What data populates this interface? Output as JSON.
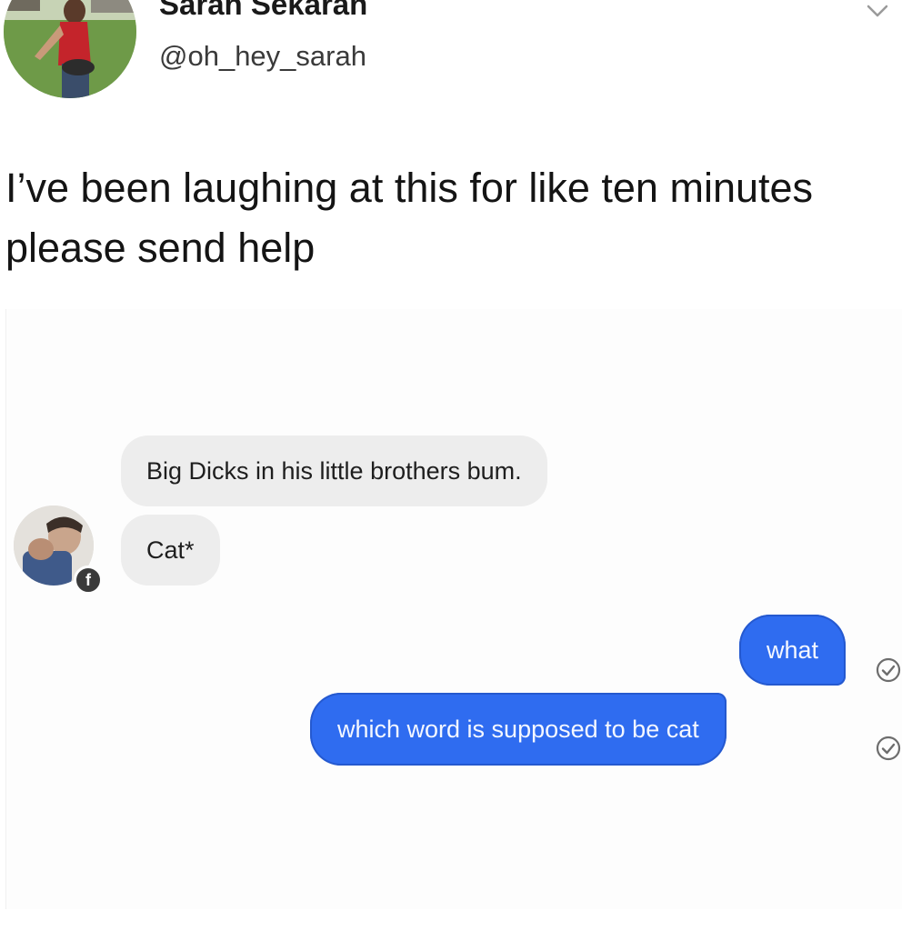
{
  "tweet": {
    "display_name": "Sarah Sekaran",
    "handle": "@oh_hey_sarah",
    "text": "I’ve been laughing at this for like ten minutes please send help"
  },
  "chat": {
    "incoming": [
      {
        "text": "Big Dicks in his little brothers bum."
      },
      {
        "text": "Cat*"
      }
    ],
    "outgoing": [
      {
        "text": "what"
      },
      {
        "text": "which word is supposed to be cat"
      }
    ],
    "colors": {
      "incoming_bubble": "#ededed",
      "outgoing_bubble": "#2f6cf0"
    },
    "icons": {
      "sender_badge": "facebook-icon",
      "delivery_status": "sent-check-icon"
    }
  }
}
